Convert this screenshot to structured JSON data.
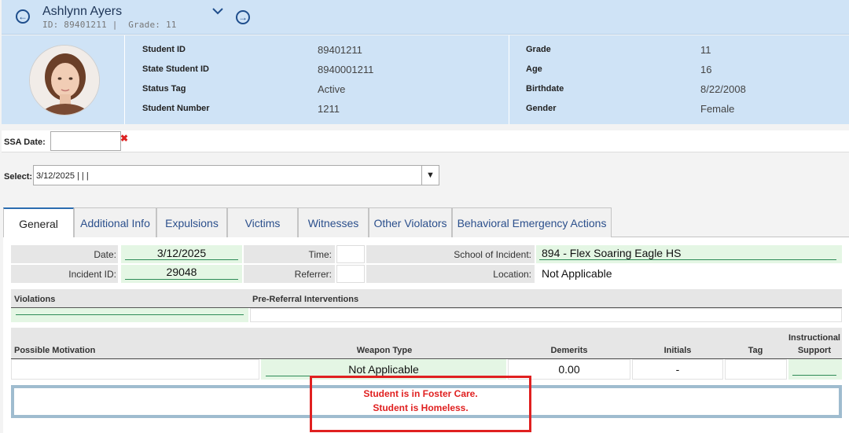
{
  "header": {
    "student_name": "Ashlynn Ayers",
    "sub_id": "ID: 89401211 |",
    "sub_grade": "Grade: 11",
    "prev_icon": "arrow-left-icon",
    "next_icon": "arrow-right-icon",
    "expand_icon": "chevron-down-icon"
  },
  "info": {
    "left": [
      {
        "label": "Student ID",
        "value": "89401211"
      },
      {
        "label": "State Student ID",
        "value": "8940001211"
      },
      {
        "label": "Status Tag",
        "value": "Active"
      },
      {
        "label": "Student Number",
        "value": "1211"
      }
    ],
    "right": [
      {
        "label": "Grade",
        "value": "11"
      },
      {
        "label": "Age",
        "value": "16"
      },
      {
        "label": "Birthdate",
        "value": "8/22/2008"
      },
      {
        "label": "Gender",
        "value": "Female"
      }
    ]
  },
  "ssa": {
    "label": "SSA Date:",
    "value": "",
    "clear_glyph": "✖"
  },
  "select": {
    "label": "Select:",
    "value": "3/12/2025 | | |",
    "arrow": "▼"
  },
  "tabs": [
    "General",
    "Additional Info",
    "Expulsions",
    "Victims",
    "Witnesses",
    "Other Violators",
    "Behavioral Emergency Actions"
  ],
  "general": {
    "date_label": "Date:",
    "date_value": "3/12/2025",
    "time_label": "Time:",
    "time_value": "",
    "school_label": "School of Incident:",
    "school_value": "894 - Flex Soaring Eagle HS",
    "incident_label": "Incident ID:",
    "incident_value": "29048",
    "referrer_label": "Referrer:",
    "referrer_value": "",
    "location_label": "Location:",
    "location_value": "Not Applicable",
    "violations_label": "Violations",
    "prereferral_label": "Pre-Referral Interventions",
    "motivation_label": "Possible Motivation",
    "weapon_label": "Weapon Type",
    "demerits_label": "Demerits",
    "initials_label": "Initials",
    "tag_label": "Tag",
    "instructional_label_1": "Instructional",
    "instructional_label_2": "Support",
    "motivation_value": "",
    "weapon_value": "Not Applicable",
    "demerits_value": "0.00",
    "initials_value": "-",
    "tag_value": "",
    "instructional_value": ""
  },
  "alerts": [
    "Student is in Foster Care.",
    "Student is Homeless."
  ],
  "colors": {
    "header_bg": "#cfe3f6",
    "accent": "#1f4e8c",
    "alert_red": "#e02020",
    "field_green": "#e4f6e4"
  }
}
